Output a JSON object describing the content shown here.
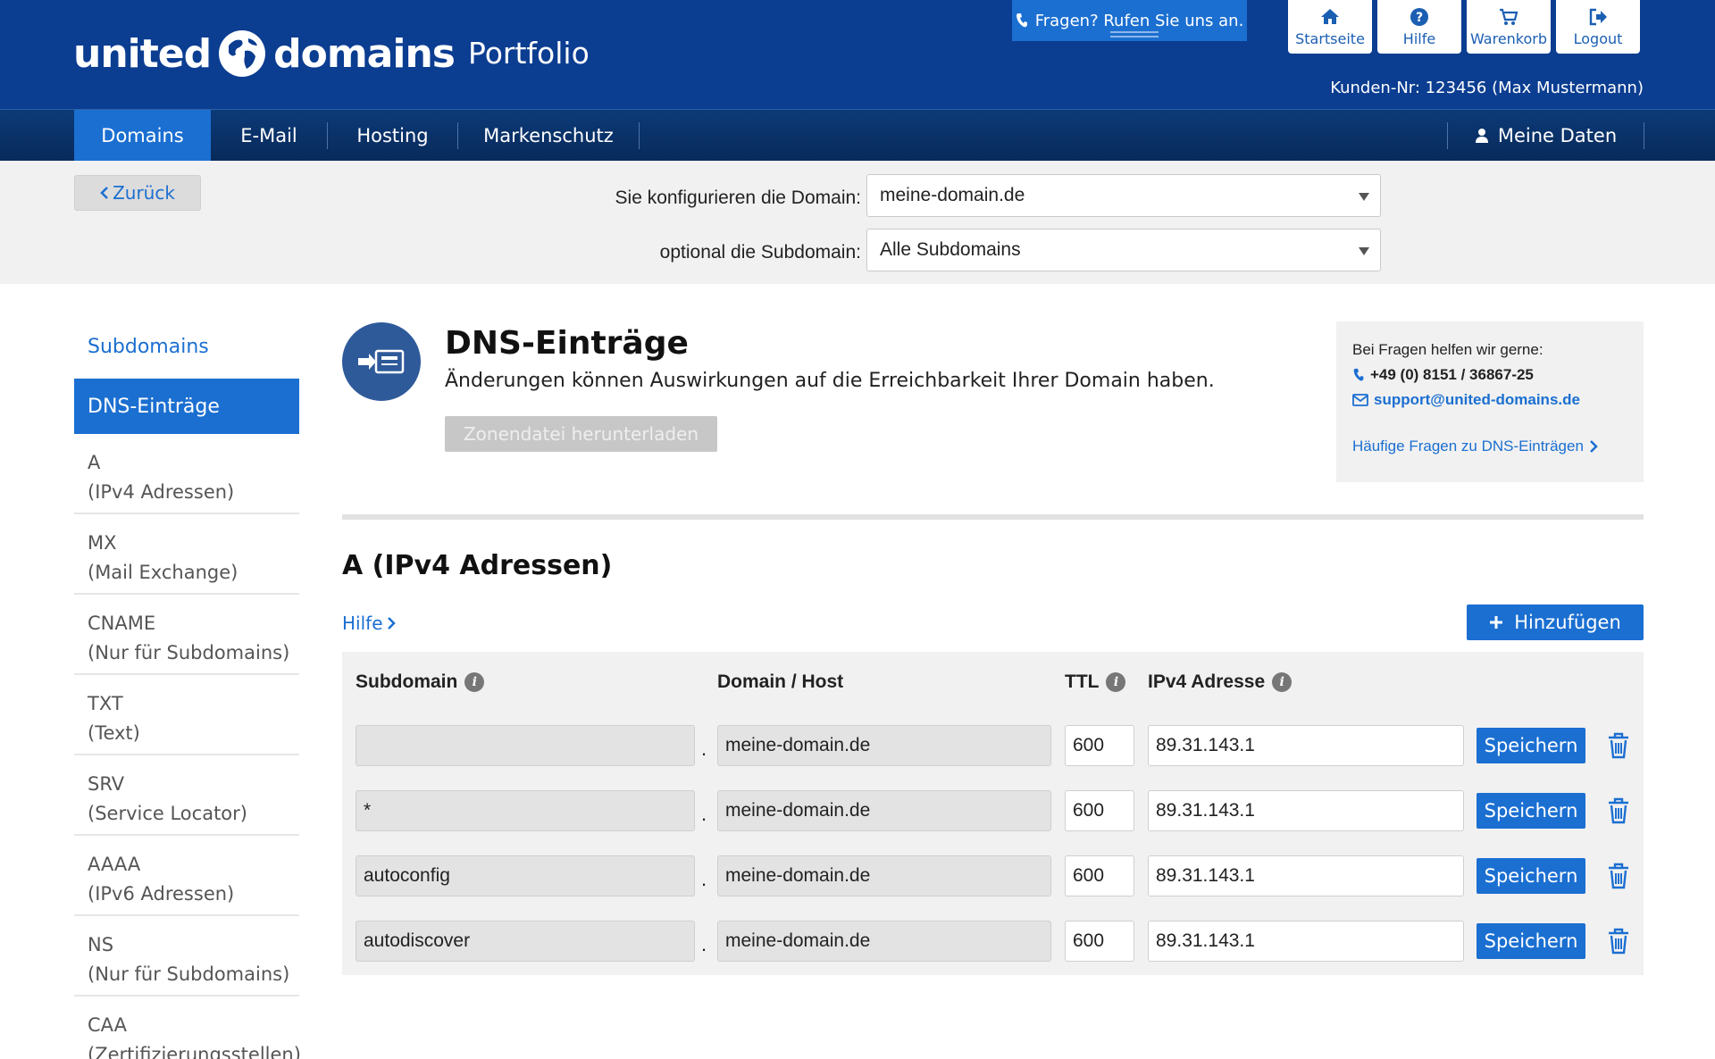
{
  "header": {
    "logo_left": "united",
    "logo_right": "domains",
    "portfolio": "Portfolio",
    "phone_tab": "Fragen? Rufen Sie uns an.",
    "top_buttons": [
      {
        "label": "Startseite",
        "icon": "home-icon"
      },
      {
        "label": "Hilfe",
        "icon": "help-icon"
      },
      {
        "label": "Warenkorb",
        "icon": "cart-icon"
      },
      {
        "label": "Logout",
        "icon": "logout-icon"
      }
    ],
    "customer": "Kunden-Nr: 123456 (Max Mustermann)"
  },
  "nav": {
    "items": [
      "Domains",
      "E-Mail",
      "Hosting",
      "Markenschutz"
    ],
    "active": "Domains",
    "account": "Meine Daten"
  },
  "config": {
    "back": "Zurück",
    "domain_label": "Sie konfigurieren die Domain:",
    "domain_value": "meine-domain.de",
    "subdomain_label": "optional die Subdomain:",
    "subdomain_value": "Alle Subdomains"
  },
  "sidebar": {
    "link": "Subdomains",
    "active": "DNS-Einträge",
    "items": [
      {
        "type": "A",
        "desc": "(IPv4 Adressen)"
      },
      {
        "type": "MX",
        "desc": "(Mail Exchange)"
      },
      {
        "type": "CNAME",
        "desc": "(Nur für Subdomains)"
      },
      {
        "type": "TXT",
        "desc": "(Text)"
      },
      {
        "type": "SRV",
        "desc": "(Service Locator)"
      },
      {
        "type": "AAAA",
        "desc": "(IPv6 Adressen)"
      },
      {
        "type": "NS",
        "desc": "(Nur für Subdomains)"
      },
      {
        "type": "CAA",
        "desc": "(Zertifizierungsstellen)"
      }
    ]
  },
  "main": {
    "title": "DNS-Einträge",
    "subtitle": "Änderungen können Auswirkungen auf die Erreichbarkeit Ihrer Domain haben.",
    "zone_button": "Zonendatei herunterladen",
    "help": {
      "intro": "Bei Fragen helfen wir gerne:",
      "phone": "+49 (0) 8151 / 36867-25",
      "email": "support@united-domains.de",
      "faq": "Häufige Fragen zu DNS-Einträgen"
    },
    "section_title": "A (IPv4 Adressen)",
    "hilfe": "Hilfe",
    "add_button": "Hinzufügen",
    "columns": {
      "subdomain": "Subdomain",
      "host": "Domain / Host",
      "ttl": "TTL",
      "ip": "IPv4 Adresse"
    },
    "save_label": "Speichern",
    "rows": [
      {
        "subdomain": "",
        "host": "meine-domain.de",
        "ttl": "600",
        "ip": "89.31.143.1"
      },
      {
        "subdomain": "*",
        "host": "meine-domain.de",
        "ttl": "600",
        "ip": "89.31.143.1"
      },
      {
        "subdomain": "autoconfig",
        "host": "meine-domain.de",
        "ttl": "600",
        "ip": "89.31.143.1"
      },
      {
        "subdomain": "autodiscover",
        "host": "meine-domain.de",
        "ttl": "600",
        "ip": "89.31.143.1"
      }
    ]
  },
  "colors": {
    "header": "#0b3d91",
    "accent": "#1b6fd1"
  }
}
